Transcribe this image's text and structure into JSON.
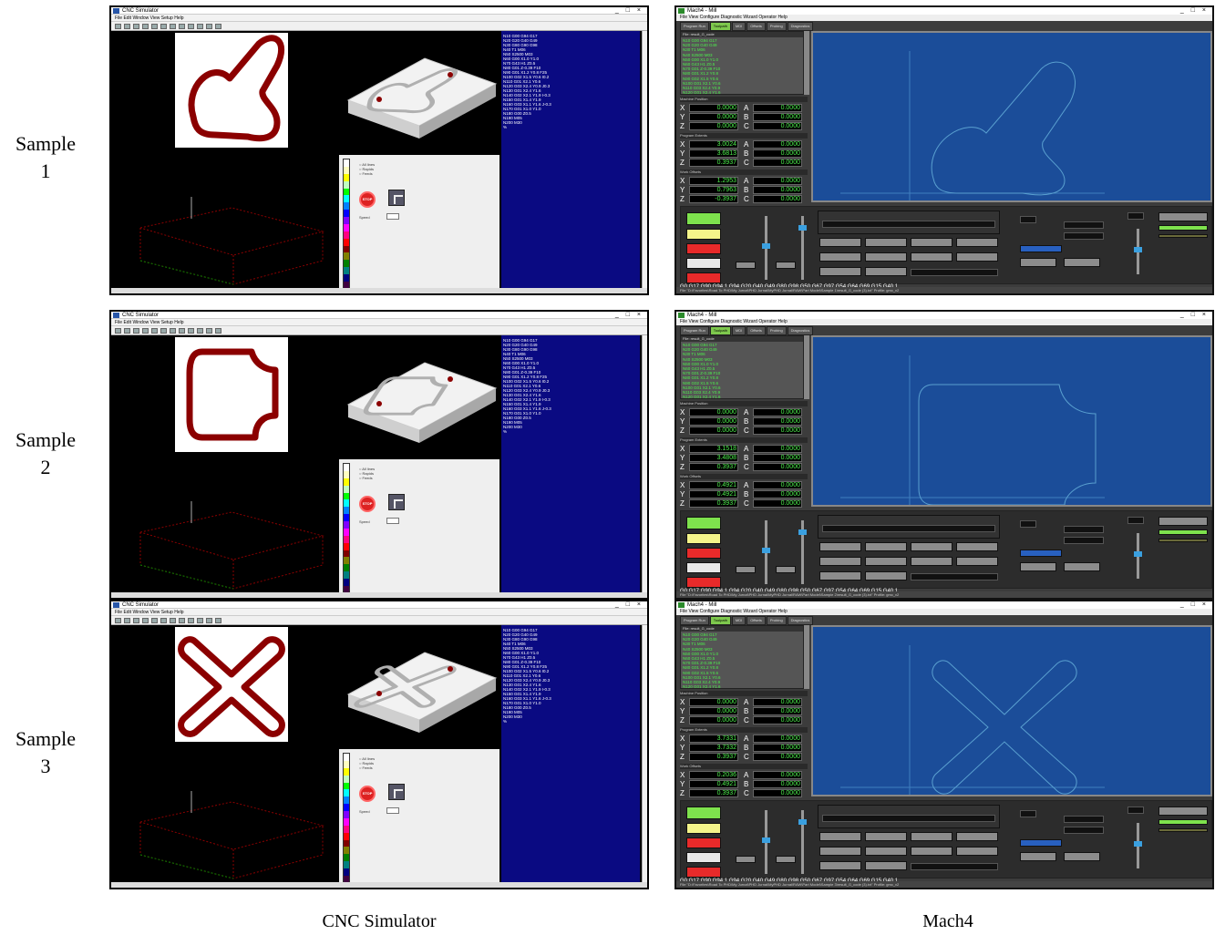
{
  "labels": {
    "rows": [
      {
        "line1": "Sample",
        "line2": "1"
      },
      {
        "line1": "Sample",
        "line2": "2"
      },
      {
        "line1": "Sample",
        "line2": "3"
      }
    ],
    "columns": [
      "CNC Simulator",
      "Mach4"
    ]
  },
  "samples": [
    {
      "shape": "hook",
      "mach_x": "0.0000",
      "mach_y": "0.0000",
      "mach_z": "0.0000",
      "prog_x": "3.0024",
      "prog_y": "3.6813",
      "prog_z": "0.3937",
      "work_x": "1.2953",
      "work_y": "0.7963",
      "work_z": "-0.3937",
      "gcode_line": "G0 G17 G90 G94.1 G94 G20 G40 G49 G80 G98 G50 G67 G97 G54 G64 G69 G15 G40.1",
      "file_line": "File \"D:\\Favorites\\Road To PHD\\My Jurnal\\PHD Jurnal\\MyPHD Jurnal\\RAW\\Part Model\\Sample 1\\result_G_code (3).txt\"",
      "profile": "Profile: gmc_v2"
    },
    {
      "shape": "square-notched",
      "mach_x": "0.0000",
      "mach_y": "0.0000",
      "mach_z": "0.0000",
      "prog_x": "3.1518",
      "prog_y": "3.4808",
      "prog_z": "0.3937",
      "work_x": "0.4921",
      "work_y": "0.4921",
      "work_z": "0.3937",
      "gcode_line": "G0 G17 G90 G94.1 G94 G20 G40 G49 G80 G98 G50 G67 G97 G54 G64 G69 G15 G40.1",
      "file_line": "File \"D:\\Favorites\\Road To PHD\\My Jurnal\\PHD Jurnal\\MyPHD Jurnal\\RAW\\Part Model\\Sample 2\\result_G_code (3).txt\"",
      "profile": "Profile: gmc_v2"
    },
    {
      "shape": "cross",
      "mach_x": "0.0000",
      "mach_y": "0.0000",
      "mach_z": "0.0000",
      "prog_x": "3.7331",
      "prog_y": "3.7332",
      "prog_z": "0.3937",
      "work_x": "0.2036",
      "work_y": "0.4921",
      "work_z": "0.3937",
      "gcode_line": "G0 G17 G90 G94.1 G94 G20 G40 G49 G80 G98 G50 G67 G97 G54 G64 G69 G15 G40.1",
      "file_line": "File \"D:\\Favorites\\Road To PHD\\My Jurnal\\PHD Jurnal\\MyPHD Jurnal\\RAW\\Part Model\\Sample 3\\result_G_code (3).txt\"",
      "profile": "Profile: gmc_v2"
    }
  ],
  "mach_axis_letters": {
    "x": "X",
    "y": "Y",
    "z": "Z",
    "a": "A",
    "b": "B",
    "c": "C"
  },
  "mach_stop_label": "STOP",
  "mach_title": "Mach4 - Mill",
  "sim_title": "CNC Simulator",
  "colors": {
    "path": "#8b0000",
    "code_bg": "#0a0a82",
    "mach_view": "#1b4d99",
    "mach_green": "#4df04d"
  }
}
